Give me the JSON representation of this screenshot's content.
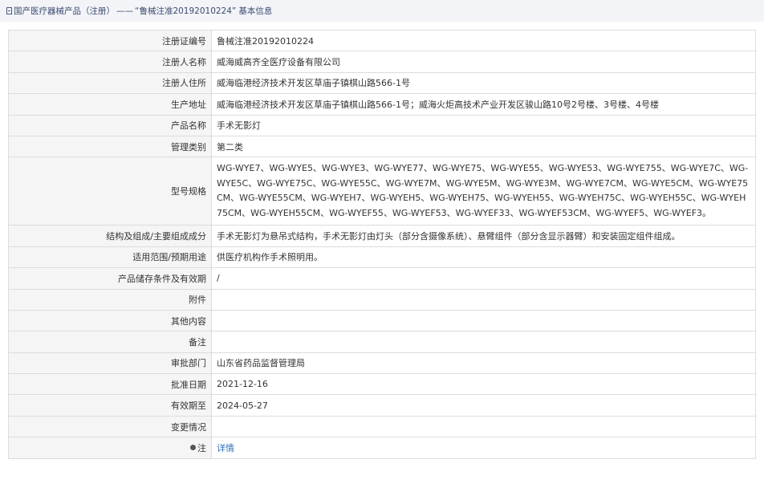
{
  "breadcrumb": {
    "root": "国产医疗器械产品（注册）",
    "separator": "——",
    "current": "“鲁械注准20192010224”",
    "suffix": "基本信息"
  },
  "rows": [
    {
      "label": "注册证编号",
      "value": "鲁械注准20192010224"
    },
    {
      "label": "注册人名称",
      "value": "威海威高齐全医疗设备有限公司"
    },
    {
      "label": "注册人住所",
      "value": "威海临港经济技术开发区草庙子镇棋山路566-1号"
    },
    {
      "label": "生产地址",
      "value": "威海临港经济技术开发区草庙子镇棋山路566-1号；威海火炬高技术产业开发区骏山路10号2号楼、3号楼、4号楼"
    },
    {
      "label": "产品名称",
      "value": "手术无影灯"
    },
    {
      "label": "管理类别",
      "value": "第二类"
    },
    {
      "label": "型号规格",
      "value": "WG-WYE7、WG-WYE5、WG-WYE3、WG-WYE77、WG-WYE75、WG-WYE55、WG-WYE53、WG-WYE755、WG-WYE7C、WG-WYE5C、WG-WYE75C、WG-WYE55C、WG-WYE7M、WG-WYE5M、WG-WYE3M、WG-WYE7CM、WG-WYE5CM、WG-WYE75CM、WG-WYE55CM、WG-WYEH7、WG-WYEH5、WG-WYEH75、WG-WYEH55、WG-WYEH75C、WG-WYEH55C、WG-WYEH75CM、WG-WYEH55CM、WG-WYEF55、WG-WYEF53、WG-WYEF33、WG-WYEF53CM、WG-WYEF5、WG-WYEF3。"
    },
    {
      "label": "结构及组成/主要组成成分",
      "value": "手术无影灯为悬吊式结构，手术无影灯由灯头（部分含摄像系统）、悬臂组件（部分含显示器臂）和安装固定组件组成。"
    },
    {
      "label": "适用范围/预期用途",
      "value": "供医疗机构作手术照明用。"
    },
    {
      "label": "产品储存条件及有效期",
      "value": "/"
    },
    {
      "label": "附件",
      "value": ""
    },
    {
      "label": "其他内容",
      "value": ""
    },
    {
      "label": "备注",
      "value": ""
    },
    {
      "label": "审批部门",
      "value": "山东省药品监督管理局"
    },
    {
      "label": "批准日期",
      "value": "2021-12-16"
    },
    {
      "label": "有效期至",
      "value": "2024-05-27"
    },
    {
      "label": "变更情况",
      "value": ""
    }
  ],
  "note_row": {
    "label": "注",
    "link_text": "详情",
    "icon": "info-pin-icon"
  },
  "colors": {
    "label_bg": "#f5f5f5",
    "border": "#dcdcdc",
    "link": "#2f6fb6",
    "topbar_bg": "#f3f4f8"
  }
}
